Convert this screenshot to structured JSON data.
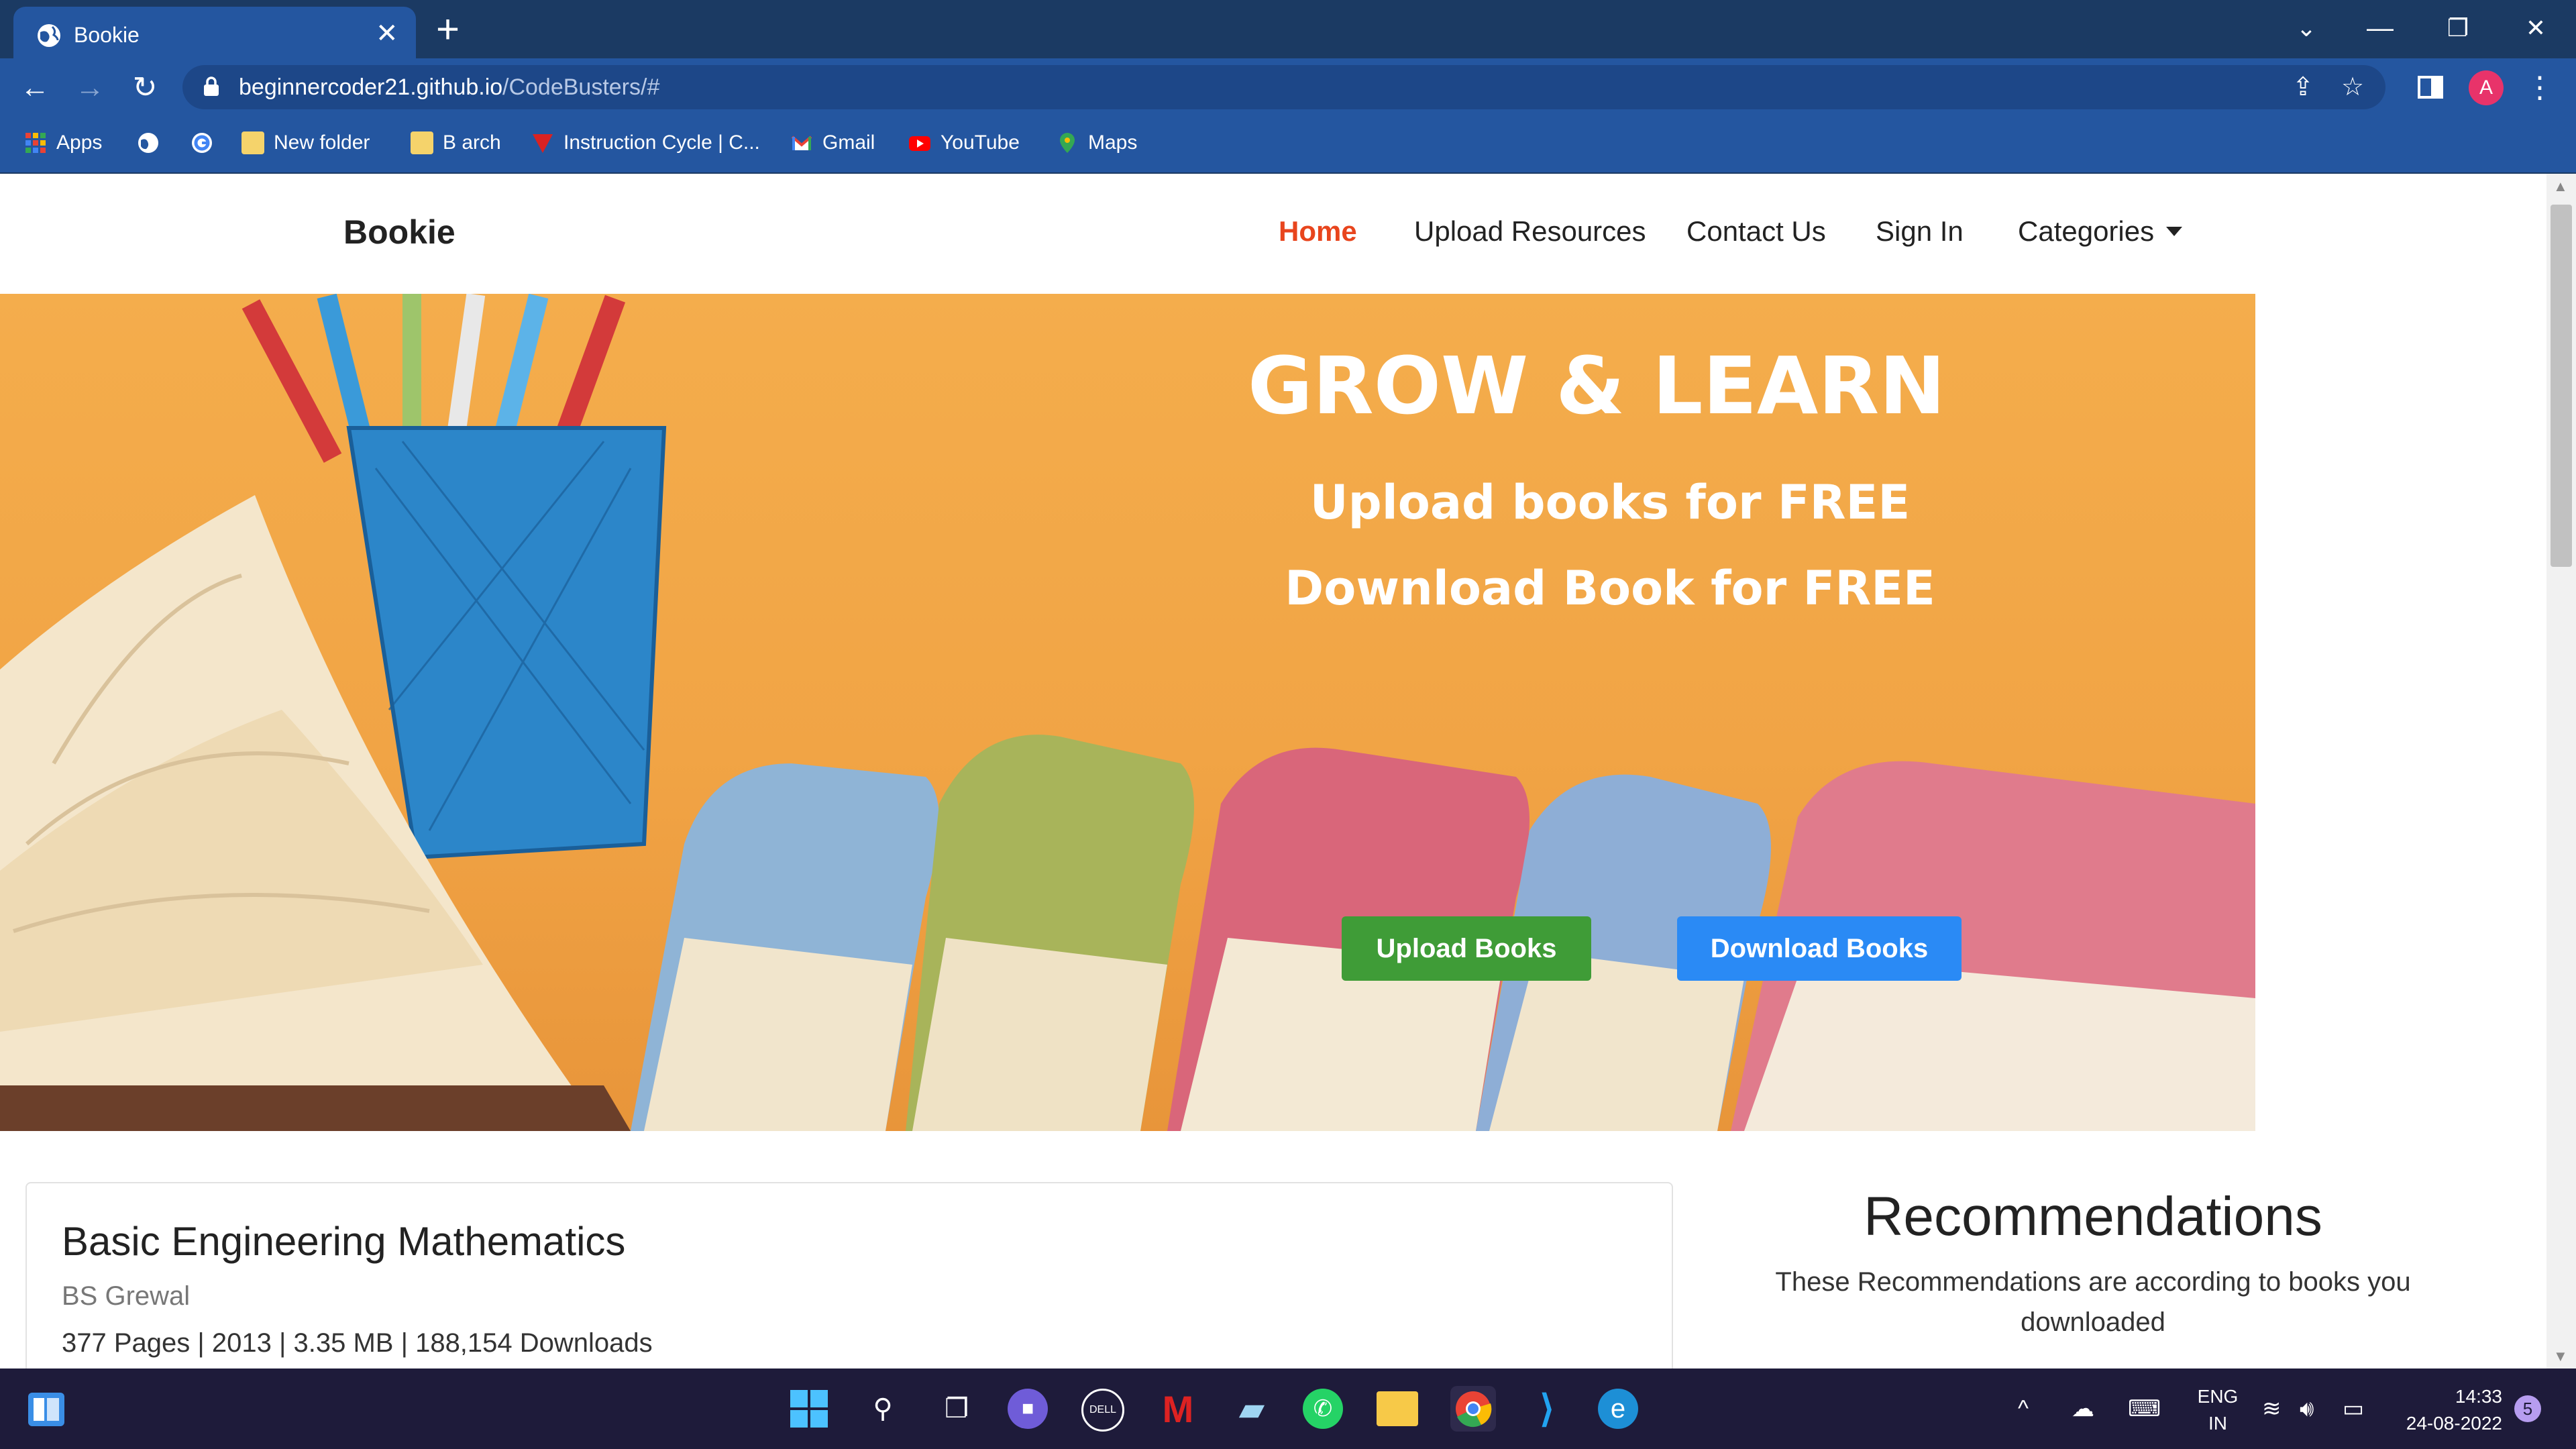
{
  "browser": {
    "tab_title": "Bookie",
    "new_tab_symbol": "+",
    "url_host": "beginnercoder21.github.io",
    "url_path": "/CodeBusters/#",
    "profile_initial": "A",
    "bookmarks": [
      {
        "label": "Apps",
        "icon": "apps-grid-icon",
        "color": "#e94235"
      },
      {
        "label": "",
        "icon": "globe-icon",
        "color": "#ffffff"
      },
      {
        "label": "",
        "icon": "google-icon",
        "color": "#ffffff"
      },
      {
        "label": "New folder",
        "icon": "folder-icon",
        "color": "#f5d36b"
      },
      {
        "label": "B arch",
        "icon": "folder-icon",
        "color": "#f5d36b"
      },
      {
        "label": "Instruction Cycle | C...",
        "icon": "bookmark-site-icon",
        "color": "#d92222"
      },
      {
        "label": "Gmail",
        "icon": "gmail-icon",
        "color": "#ea4335"
      },
      {
        "label": "YouTube",
        "icon": "youtube-icon",
        "color": "#ff0000"
      },
      {
        "label": "Maps",
        "icon": "maps-icon",
        "color": "#34a853"
      }
    ]
  },
  "site": {
    "brand": "Bookie",
    "nav": [
      {
        "label": "Home",
        "active": true
      },
      {
        "label": "Upload Resources"
      },
      {
        "label": "Contact Us"
      },
      {
        "label": "Sign In"
      },
      {
        "label": "Categories"
      }
    ],
    "hero": {
      "headline": "GROW & LEARN",
      "line1": "Upload books for FREE",
      "line2": "Download Book for FREE",
      "upload_button": "Upload Books",
      "download_button": "Download Books"
    },
    "book": {
      "title": "Basic Engineering Mathematics",
      "author": "BS Grewal",
      "meta": "377 Pages | 2013 | 3.35 MB | 188,154 Downloads"
    },
    "recommendations": {
      "title": "Recommendations",
      "subtitle": "These Recommendations are according to books you downloaded"
    }
  },
  "taskbar": {
    "language": "ENG",
    "region": "IN",
    "time": "14:33",
    "date": "24-08-2022",
    "notification_count": "5"
  },
  "colors": {
    "accent_home": "#e8451d",
    "upload_button": "#3f9c37",
    "download_button": "#2a8af5",
    "hero_bg": "#f4ad4c",
    "chrome_blue": "#2456a0"
  }
}
